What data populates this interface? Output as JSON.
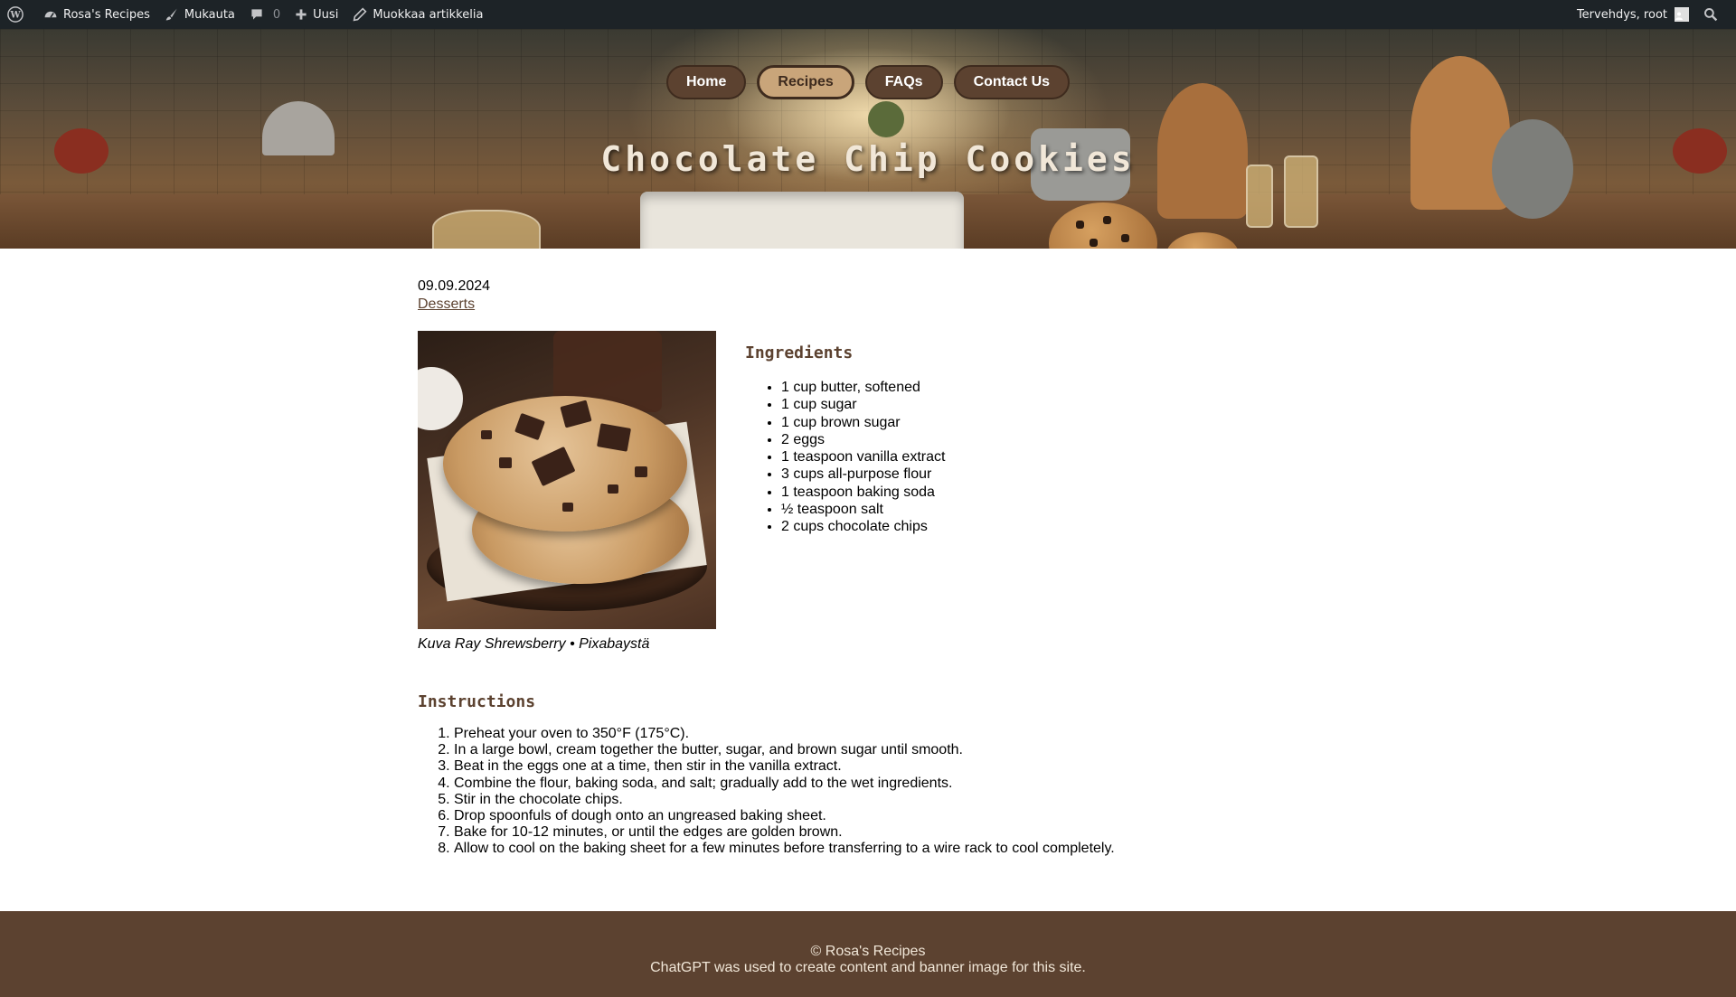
{
  "adminbar": {
    "site_name": "Rosa's Recipes",
    "customize": "Mukauta",
    "comments_count": "0",
    "new": "Uusi",
    "edit_post": "Muokkaa artikkelia",
    "greeting": "Tervehdys, root"
  },
  "nav": {
    "items": [
      {
        "label": "Home"
      },
      {
        "label": "Recipes",
        "active": true
      },
      {
        "label": "FAQs"
      },
      {
        "label": "Contact Us"
      }
    ]
  },
  "banner": {
    "title": "Chocolate Chip Cookies"
  },
  "post": {
    "date": "09.09.2024",
    "category": "Desserts",
    "image_caption": "Kuva Ray Shrewsberry • Pixabaystä"
  },
  "ingredients": {
    "heading": "Ingredients",
    "items": [
      "1 cup butter, softened",
      "1 cup sugar",
      "1 cup brown sugar",
      "2 eggs",
      "1 teaspoon vanilla extract",
      "3 cups all-purpose flour",
      "1 teaspoon baking soda",
      "½ teaspoon salt",
      "2 cups chocolate chips"
    ]
  },
  "instructions": {
    "heading": "Instructions",
    "items": [
      "Preheat your oven to 350°F (175°C).",
      "In a large bowl, cream together the butter, sugar, and brown sugar until smooth.",
      "Beat in the eggs one at a time, then stir in the vanilla extract.",
      "Combine the flour, baking soda, and salt; gradually add to the wet ingredients.",
      "Stir in the chocolate chips.",
      "Drop spoonfuls of dough onto an ungreased baking sheet.",
      "Bake for 10-12 minutes, or until the edges are golden brown.",
      "Allow to cool on the baking sheet for a few minutes before transferring to a wire rack to cool completely."
    ]
  },
  "footer": {
    "copyright": "© Rosa's Recipes",
    "note": "ChatGPT was used to create content and banner image for this site."
  },
  "colors": {
    "adminbar_bg": "#1d2327",
    "brand_brown": "#5c4230",
    "nav_active": "#c9a57a",
    "footer_text": "#f1e7d8"
  }
}
